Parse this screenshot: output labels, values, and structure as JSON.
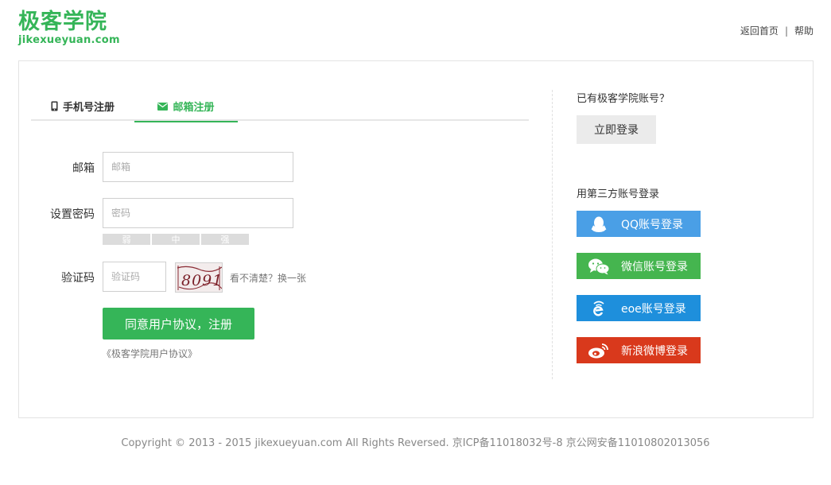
{
  "header": {
    "logo_cn": "极客学院",
    "logo_en": "jikexueyuan.com",
    "link_home": "返回首页",
    "link_sep": "|",
    "link_help": "帮助"
  },
  "tabs": [
    {
      "label": "手机号注册",
      "icon": "mobile-phone-icon",
      "active": false
    },
    {
      "label": "邮箱注册",
      "icon": "envelope-icon",
      "active": true
    }
  ],
  "form": {
    "email_label": "邮箱",
    "email_placeholder": "邮箱",
    "password_label": "设置密码",
    "password_placeholder": "密码",
    "strength": [
      "弱",
      "中",
      "强"
    ],
    "captcha_label": "验证码",
    "captcha_placeholder": "验证码",
    "captcha_text": "8091",
    "refresh_text": "看不清楚？换一张",
    "submit_label": "同意用户协议，注册",
    "agreement_link": "《极客学院用户协议》"
  },
  "sidebar": {
    "has_account": "已有极客学院账号？",
    "login_button": "立即登录",
    "third_party_label": "用第三方账号登录",
    "social": [
      {
        "label": "QQ账号登录",
        "icon": "qq-penguin-icon",
        "color": "#4a9fe6"
      },
      {
        "label": "微信账号登录",
        "icon": "wechat-icon",
        "color": "#45b54f"
      },
      {
        "label": "eoe账号登录",
        "icon": "eoe-icon",
        "color": "#1e8fdc"
      },
      {
        "label": "新浪微博登录",
        "icon": "weibo-icon",
        "color": "#d9391c"
      }
    ]
  },
  "footer": {
    "text": "Copyright © 2013 - 2015 jikexueyuan.com All Rights Reversed. 京ICP备11018032号-8 京公网安备11010802013056"
  },
  "colors": {
    "brand": "#35b558",
    "border": "#e3e3e3"
  }
}
